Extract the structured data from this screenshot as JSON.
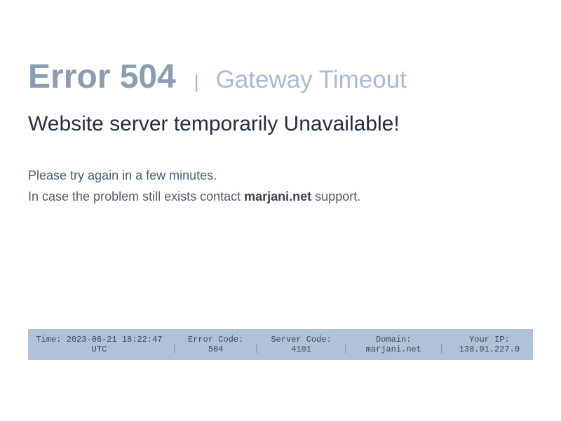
{
  "headline": {
    "code": "Error 504",
    "separator": "|",
    "text": "Gateway Timeout"
  },
  "subtitle": "Website server temporarily Unavailable!",
  "message": {
    "line1": "Please try again in a few minutes.",
    "line2_before": "In case the problem still exists contact ",
    "line2_brand": "marjani.net",
    "line2_after": " support."
  },
  "info_bar": {
    "time_label": "Time: 2023-06-21 18:22:47",
    "time_tz": "UTC",
    "error_code_label": "Error Code:",
    "error_code_value": "504",
    "server_code_label": "Server Code:",
    "server_code_value": "4101",
    "domain_label": "Domain:",
    "domain_value": "marjani.net",
    "ip_label": "Your IP:",
    "ip_value": "138.91.227.0",
    "divider": "|"
  },
  "colors": {
    "code": "#8a9db4",
    "headline_text": "#a9bbd0",
    "subtitle": "#24303c",
    "info_bar_bg": "#b0c2d8"
  }
}
